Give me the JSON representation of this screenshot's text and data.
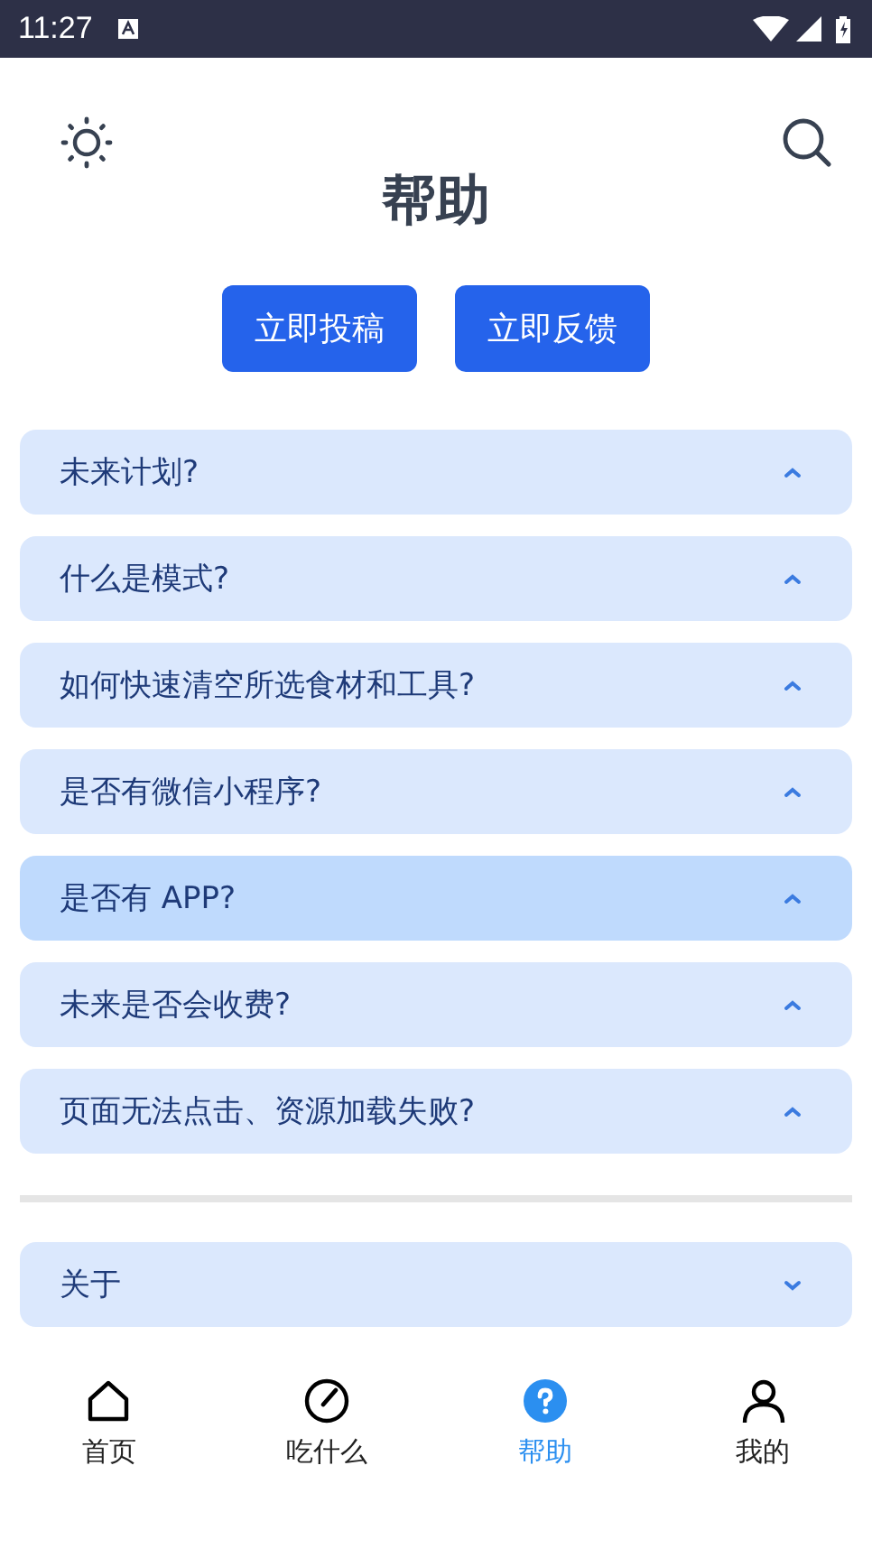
{
  "status_bar": {
    "time": "11:27"
  },
  "header": {
    "title": "帮助"
  },
  "actions": [
    {
      "label": "立即投稿"
    },
    {
      "label": "立即反馈"
    }
  ],
  "faq": [
    {
      "question": "未来计划?",
      "selected": false,
      "expanded": true
    },
    {
      "question": "什么是模式?",
      "selected": false,
      "expanded": true
    },
    {
      "question": "如何快速清空所选食材和工具?",
      "selected": false,
      "expanded": true
    },
    {
      "question": "是否有微信小程序?",
      "selected": false,
      "expanded": true
    },
    {
      "question": "是否有 APP?",
      "selected": true,
      "expanded": true
    },
    {
      "question": "未来是否会收费?",
      "selected": false,
      "expanded": true
    },
    {
      "question": "页面无法点击、资源加载失败?",
      "selected": false,
      "expanded": true
    }
  ],
  "about": [
    {
      "question": "关于",
      "selected": false,
      "expanded": false
    }
  ],
  "tab_bar": [
    {
      "label": "首页",
      "kind": "home",
      "selected": false
    },
    {
      "label": "吃什么",
      "kind": "gauge",
      "selected": false
    },
    {
      "label": "帮助",
      "kind": "help",
      "selected": true
    },
    {
      "label": "我的",
      "kind": "user",
      "selected": false
    }
  ]
}
